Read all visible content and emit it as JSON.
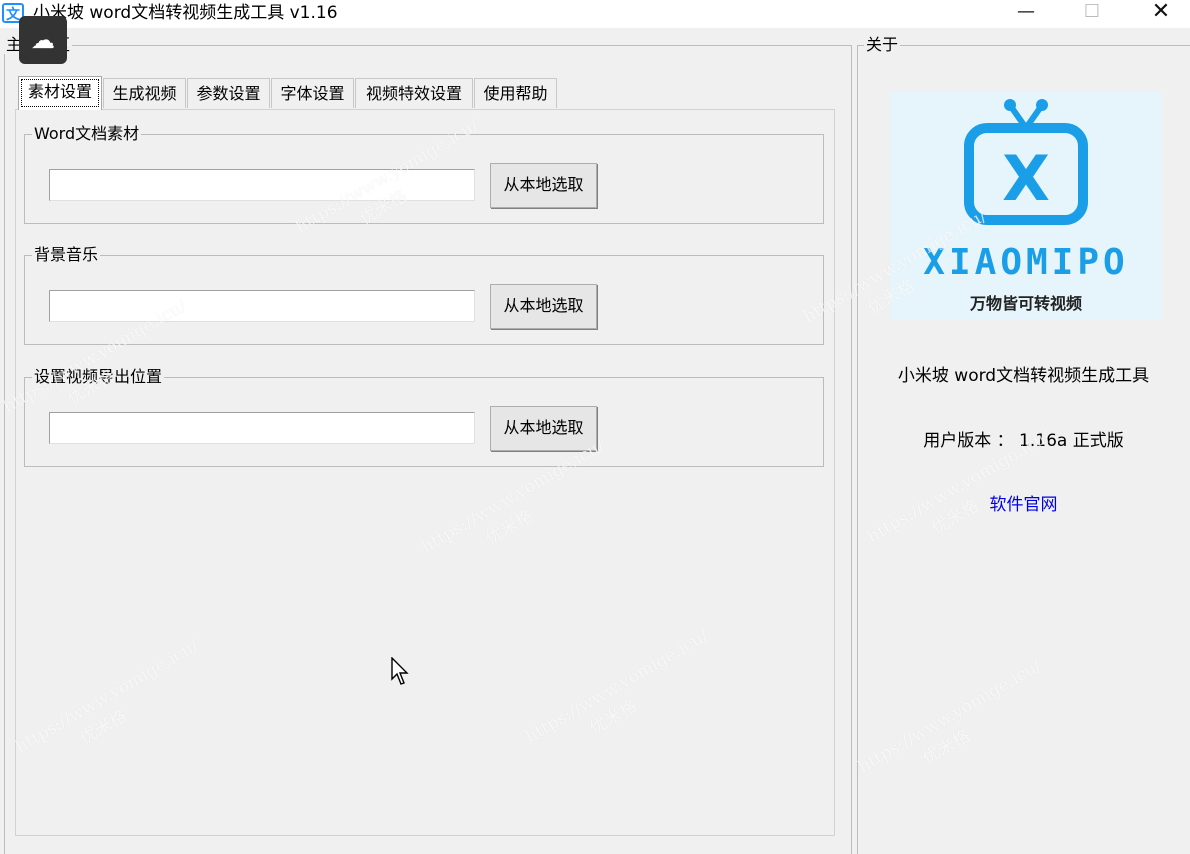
{
  "window": {
    "title": "小米坡 word文档转视频生成工具 v1.16",
    "app_icon": "doc-translate-icon",
    "controls": {
      "minimize": "—",
      "maximize": "☐",
      "close": "✕"
    }
  },
  "main_area": {
    "legend": "主功能区"
  },
  "tabs": [
    {
      "label": "素材设置",
      "active": true
    },
    {
      "label": "生成视频"
    },
    {
      "label": "参数设置"
    },
    {
      "label": "字体设置"
    },
    {
      "label": "视频特效设置"
    },
    {
      "label": "使用帮助"
    }
  ],
  "groups": [
    {
      "legend": "Word文档素材",
      "value": "",
      "button": "从本地选取"
    },
    {
      "legend": "背景音乐",
      "value": "",
      "button": "从本地选取"
    },
    {
      "legend": "设置视频导出位置",
      "value": "",
      "button": "从本地选取"
    }
  ],
  "about": {
    "legend": "关于",
    "logo_word": "XIAOMIPO",
    "logo_slogan": "万物皆可转视频",
    "app_name": "小米坡 word文档转视频生成工具",
    "version": "用户版本 ： 1.16a 正式版",
    "website_link": "软件官网",
    "link_color": "#0000ee",
    "logo_color": "#1a9ee8"
  },
  "watermark": {
    "line1": "https://www.yomige.icu/",
    "line2": "优米格"
  }
}
